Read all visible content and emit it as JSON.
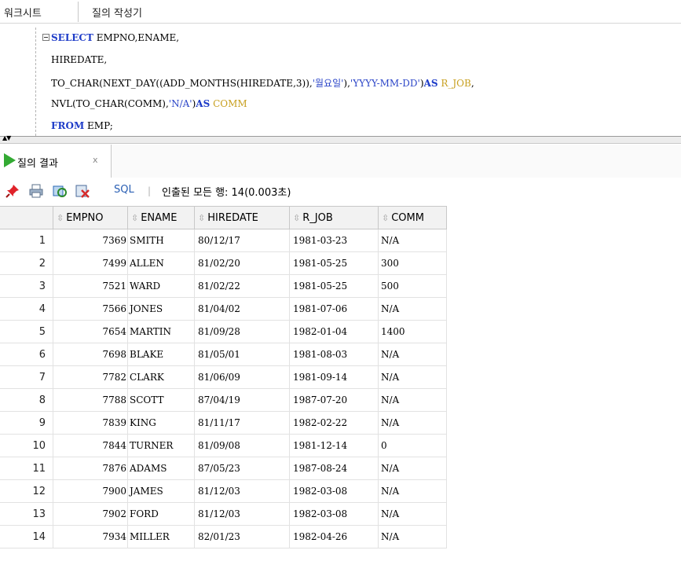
{
  "tabs": {
    "worksheet": "워크시트",
    "query_builder": "질의 작성기"
  },
  "editor": {
    "lines": [
      [
        "SELECT",
        " EMPNO,ENAME,"
      ],
      [
        "HIREDATE,"
      ],
      [
        "TO_CHAR(NEXT_DAY((ADD_MONTHS(HIREDATE,3)),",
        "'월요일'",
        "),",
        "'YYYY-MM-DD'",
        ")",
        "AS",
        " ",
        "R_JOB",
        ","
      ],
      [
        "NVL(TO_CHAR(COMM),",
        "'N/A'",
        ")",
        "AS",
        " ",
        "COMM"
      ],
      [
        "FROM",
        " EMP;"
      ]
    ]
  },
  "results": {
    "tab_label": "질의 결과",
    "tab_close": "x",
    "sql_link": "SQL",
    "separator": "|",
    "fetch_status": "인출된 모든 행: 14(0.003초)",
    "columns": [
      "EMPNO",
      "ENAME",
      "HIREDATE",
      "R_JOB",
      "COMM"
    ],
    "sort_glyph": "⇳",
    "rows": [
      [
        "1",
        "7369",
        "SMITH",
        "80/12/17",
        "1981-03-23",
        "N/A"
      ],
      [
        "2",
        "7499",
        "ALLEN",
        "81/02/20",
        "1981-05-25",
        "300"
      ],
      [
        "3",
        "7521",
        "WARD",
        "81/02/22",
        "1981-05-25",
        "500"
      ],
      [
        "4",
        "7566",
        "JONES",
        "81/04/02",
        "1981-07-06",
        "N/A"
      ],
      [
        "5",
        "7654",
        "MARTIN",
        "81/09/28",
        "1982-01-04",
        "1400"
      ],
      [
        "6",
        "7698",
        "BLAKE",
        "81/05/01",
        "1981-08-03",
        "N/A"
      ],
      [
        "7",
        "7782",
        "CLARK",
        "81/06/09",
        "1981-09-14",
        "N/A"
      ],
      [
        "8",
        "7788",
        "SCOTT",
        "87/04/19",
        "1987-07-20",
        "N/A"
      ],
      [
        "9",
        "7839",
        "KING",
        "81/11/17",
        "1982-02-22",
        "N/A"
      ],
      [
        "10",
        "7844",
        "TURNER",
        "81/09/08",
        "1981-12-14",
        "0"
      ],
      [
        "11",
        "7876",
        "ADAMS",
        "87/05/23",
        "1987-08-24",
        "N/A"
      ],
      [
        "12",
        "7900",
        "JAMES",
        "81/12/03",
        "1982-03-08",
        "N/A"
      ],
      [
        "13",
        "7902",
        "FORD",
        "81/12/03",
        "1982-03-08",
        "N/A"
      ],
      [
        "14",
        "7934",
        "MILLER",
        "82/01/23",
        "1982-04-26",
        "N/A"
      ]
    ]
  },
  "colors": {
    "keyword": "#1e3cc8",
    "string": "#2c46c8",
    "alias": "#c8a020",
    "run_icon": "#33aa33",
    "link": "#2a5fb4"
  }
}
